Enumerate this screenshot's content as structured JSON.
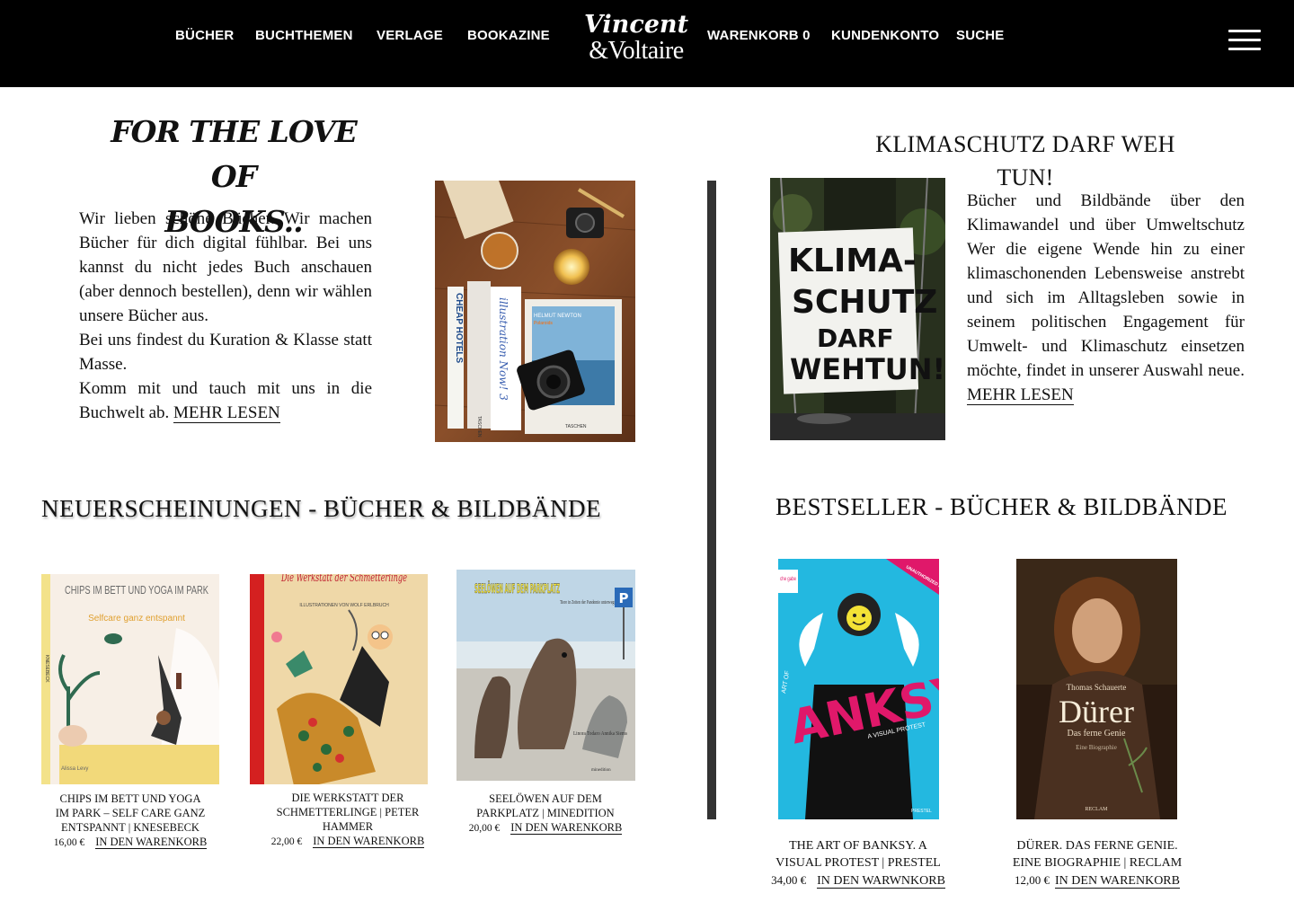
{
  "header": {
    "nav_left": [
      "BÜCHER",
      "BUCHTHEMEN",
      "VERLAGE",
      "BOOKAZINE"
    ],
    "logo_line1": "Vincent",
    "logo_line2": "&Voltaire",
    "nav_right": [
      "WARENKORB 0",
      "KUNDENKONTO",
      "SUCHE"
    ],
    "menu_icon": "hamburger-menu-icon"
  },
  "intro": {
    "title_line1": "FOR THE LOVE OF",
    "title_line2": "BOOKS..",
    "para1": "Wir lieben schöne Bücher. Wir machen Bücher für dich digital fühlbar. Bei uns kannst du nicht jedes Buch anschauen (aber dennoch bestellen), denn wir wählen unsere Bücher aus.",
    "para2": "Bei uns findest du Kuration & Klasse statt Masse.",
    "para3": "Komm mit und tauch mit uns in die Buchwelt ab.",
    "more": "MEHR LESEN",
    "photo_books": [
      "CHEAP HOTELS",
      "illustration Now! 3",
      "HELMUT NEWTON",
      "Polaroids",
      "TASCHEN",
      "TASCHEN"
    ]
  },
  "klima": {
    "title_line1": "KLIMASCHUTZ DARF WEH",
    "title_line2": "TUN!",
    "text": "Bücher und Bildbände über den Klimawandel und über Umweltschutz Wer die eigene Wende hin zu einer klimaschonenden Lebensweise anstrebt und sich im Alltagsleben sowie in seinem politischen Engagement für Umwelt- und Klimaschutz einsetzen möchte, findet in unserer Auswahl neue.",
    "more": "MEHR LESEN",
    "sign_lines": [
      "KLIMA-",
      "SCHUTZ",
      "DARF",
      "WEHTUN!"
    ]
  },
  "new_releases": {
    "heading": "NEUERSCHEINUNGEN - BÜCHER & BILDBÄNDE",
    "items": [
      {
        "cover_title": "CHIPS IM BETT UND YOGA IM PARK",
        "cover_subtitle": "Selfcare ganz entspannt",
        "cover_author": "Alissa Levy",
        "cover_spine": "KNESEBECK",
        "caption": "CHIPS IM BETT UND YOGA IM PARK – SELF CARE GANZ ENTSPANNT | KNESEBECK",
        "price": "16,00 €",
        "cart": "IN DEN WARENKORB"
      },
      {
        "cover_title": "Die Werkstatt der Schmetterlinge",
        "cover_subtitle": "ILLUSTRATIONEN VON WOLF ERLBRUCH",
        "caption": "DIE WERKSTATT DER SCHMETTERLINGE | PETER HAMMER",
        "price": "22,00 €",
        "cart": "IN DEN WARENKORB"
      },
      {
        "cover_title": "SEELÖWEN AUF DEM PARKPLATZ",
        "cover_subtitle": "Tiere in Zeiten der Pandemie unterwegs",
        "cover_author": "Linora Todaro Annika Siems",
        "cover_publisher": "minedition",
        "cover_sign": "P",
        "caption": "SEELÖWEN AUF DEM PARKPLATZ | MINEDITION",
        "price": "20,00 €",
        "cart": "IN DEN WARENKORB"
      }
    ]
  },
  "bestsellers": {
    "heading": "BESTSELLER - BÜCHER & BILDBÄNDE",
    "items": [
      {
        "cover_title": "ANKSY",
        "cover_subtitle": "A VISUAL PROTEST",
        "cover_band": "UNAUTHORIZED & UNO",
        "cover_corner": "che gabe",
        "cover_side": "ART OF",
        "cover_publisher": "PRESTEL",
        "caption": "THE ART OF BANKSY. A VISUAL PROTEST | PRESTEL",
        "price": "34,00 €",
        "cart": "IN DEN WARWNKORB"
      },
      {
        "cover_author": "Thomas Schauerte",
        "cover_title": "Dürer",
        "cover_subtitle": "Das ferne Genie",
        "cover_note": "Eine Biographie",
        "cover_publisher": "RECLAM",
        "caption": "DÜRER. DAS FERNE GENIE. EINE BIOGRAPHIE | RECLAM",
        "price": "12,00 €",
        "cart": "IN DEN WARENKORB"
      }
    ]
  },
  "colors": {
    "header_bg": "#000000",
    "divider": "#333333",
    "text": "#111111"
  }
}
